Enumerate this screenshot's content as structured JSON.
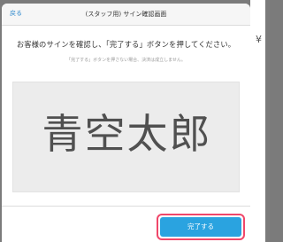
{
  "header": {
    "back_label": "戻る",
    "title": "(スタッフ用) サイン確認画面"
  },
  "content": {
    "instruction": "お客様のサインを確認し、「完了する」ボタンを押してください。",
    "note": "「完了する」ボタンを押さない場合、決済は成立しません。"
  },
  "signature": {
    "text": "青空太郎"
  },
  "footer": {
    "complete_label": "完了する"
  },
  "background": {
    "partial_mark": "¥"
  },
  "colors": {
    "accent": "#2aa3e0",
    "highlight": "#f0476a",
    "link": "#2d88cc"
  }
}
